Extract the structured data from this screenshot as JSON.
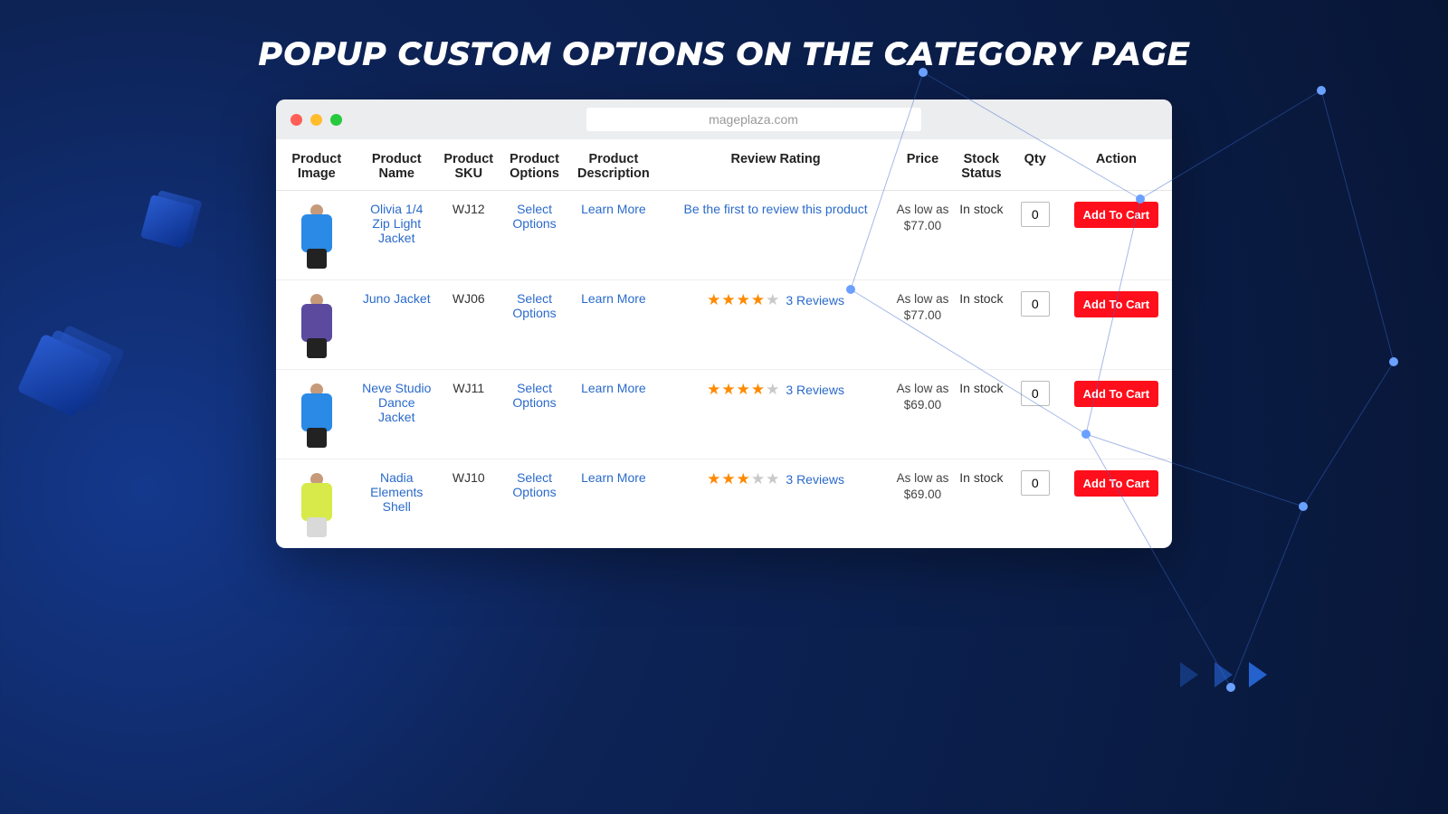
{
  "page_title": "POPUP CUSTOM OPTIONS ON THE CATEGORY PAGE",
  "browser": {
    "url": "mageplaza.com"
  },
  "columns": {
    "image": "Product Image",
    "name": "Product Name",
    "sku": "Product SKU",
    "options": "Product Options",
    "description": "Product Description",
    "review": "Review Rating",
    "price": "Price",
    "stock": "Stock Status",
    "qty": "Qty",
    "action": "Action"
  },
  "labels": {
    "select_options": "Select Options",
    "learn_more": "Learn More",
    "add_to_cart": "Add To Cart",
    "as_low_as": "As low as",
    "in_stock": "In stock",
    "first_review": "Be the first to review this product",
    "reviews_suffix": "Reviews"
  },
  "rows": [
    {
      "name": "Olivia 1/4 Zip Light Jacket",
      "sku": "WJ12",
      "thumb": "blue",
      "rating": 0,
      "review_count": 0,
      "price": "$77.00",
      "qty": "0"
    },
    {
      "name": "Juno Jacket",
      "sku": "WJ06",
      "thumb": "purple",
      "rating": 4,
      "review_count": 3,
      "price": "$77.00",
      "qty": "0"
    },
    {
      "name": "Neve Studio Dance Jacket",
      "sku": "WJ11",
      "thumb": "blue",
      "rating": 4,
      "review_count": 3,
      "price": "$69.00",
      "qty": "0"
    },
    {
      "name": "Nadia Elements Shell",
      "sku": "WJ10",
      "thumb": "lime",
      "rating": 3,
      "review_count": 3,
      "price": "$69.00",
      "qty": "0"
    }
  ]
}
